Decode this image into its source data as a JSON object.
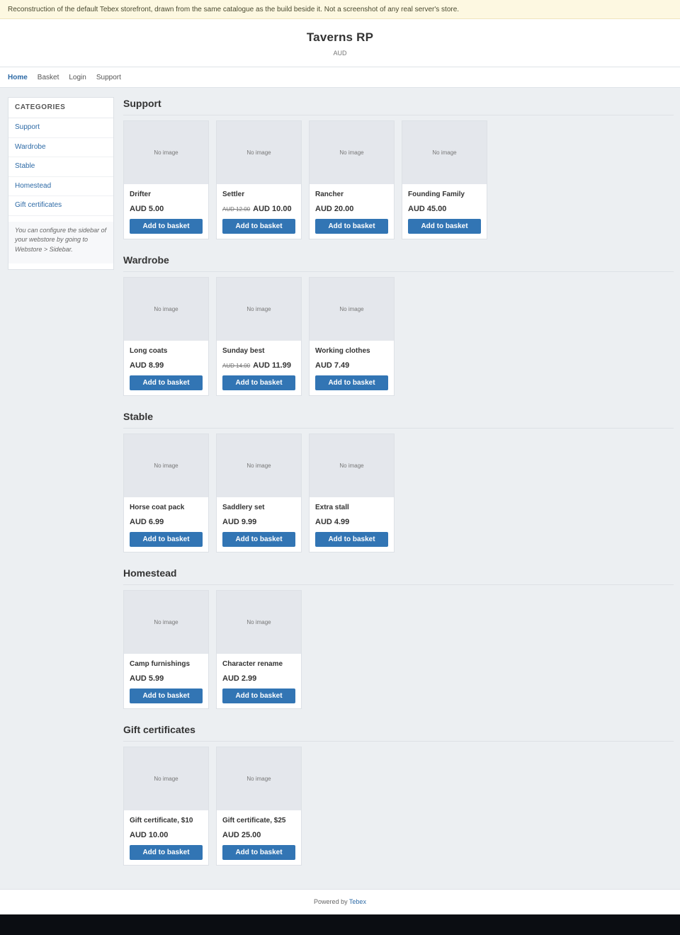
{
  "notice": "Reconstruction of the default Tebex storefront, drawn from the same catalogue as the build beside it. Not a screenshot of any real server's store.",
  "header": {
    "store_name": "Taverns RP",
    "currency": "AUD"
  },
  "nav": {
    "home": "Home",
    "basket": "Basket",
    "login": "Login",
    "support": "Support"
  },
  "sidebar": {
    "title": "CATEGORIES",
    "items": [
      "Support",
      "Wardrobe",
      "Stable",
      "Homestead",
      "Gift certificates"
    ],
    "note": "You can configure the sidebar of your webstore by going to Webstore > Sidebar."
  },
  "no_image_label": "No image",
  "sections": [
    {
      "title": "Support",
      "products": [
        {
          "name": "Drifter",
          "price": "AUD 5.00",
          "old_price": ""
        },
        {
          "name": "Settler",
          "price": "AUD 10.00",
          "old_price": "AUD 12.00"
        },
        {
          "name": "Rancher",
          "price": "AUD 20.00",
          "old_price": ""
        },
        {
          "name": "Founding Family",
          "price": "AUD 45.00",
          "old_price": ""
        }
      ]
    },
    {
      "title": "Wardrobe",
      "products": [
        {
          "name": "Long coats",
          "price": "AUD 8.99",
          "old_price": ""
        },
        {
          "name": "Sunday best",
          "price": "AUD 11.99",
          "old_price": "AUD 14.00"
        },
        {
          "name": "Working clothes",
          "price": "AUD 7.49",
          "old_price": ""
        }
      ]
    },
    {
      "title": "Stable",
      "products": [
        {
          "name": "Horse coat pack",
          "price": "AUD 6.99",
          "old_price": ""
        },
        {
          "name": "Saddlery set",
          "price": "AUD 9.99",
          "old_price": ""
        },
        {
          "name": "Extra stall",
          "price": "AUD 4.99",
          "old_price": ""
        }
      ]
    },
    {
      "title": "Homestead",
      "products": [
        {
          "name": "Camp furnishings",
          "price": "AUD 5.99",
          "old_price": ""
        },
        {
          "name": "Character rename",
          "price": "AUD 2.99",
          "old_price": ""
        }
      ]
    },
    {
      "title": "Gift certificates",
      "products": [
        {
          "name": "Gift certificate, $10",
          "price": "AUD 10.00",
          "old_price": ""
        },
        {
          "name": "Gift certificate, $25",
          "price": "AUD 25.00",
          "old_price": ""
        }
      ]
    }
  ],
  "add_to_basket_label": "Add to basket",
  "footer": {
    "prefix": "Powered by",
    "link": "Tebex"
  },
  "colors": {
    "accent": "#3275b4",
    "link": "#2d6aa6",
    "background": "#eceff2",
    "notice_bg": "#fdf8e1"
  }
}
